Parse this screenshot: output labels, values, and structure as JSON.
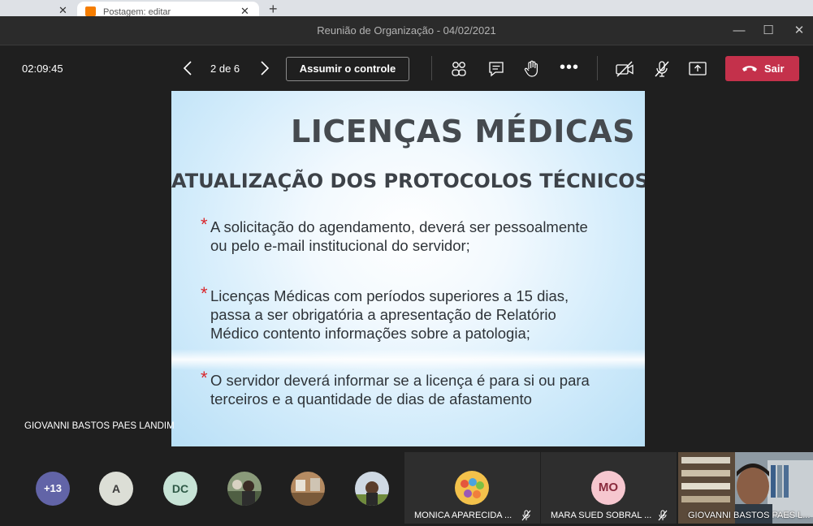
{
  "browser": {
    "tab_title": "Postagem: editar"
  },
  "window": {
    "title": "Reunião de Organização - 04/02/2021"
  },
  "toolbar": {
    "elapsed_time": "02:09:45",
    "page_indicator": "2 de 6",
    "take_control_label": "Assumir o controle",
    "leave_label": "Sair",
    "leave_color": "#c4314b"
  },
  "slide": {
    "title": "LICENÇAS MÉDICAS",
    "subtitle": "ATUALIZAÇÃO DOS PROTOCOLOS TÉCNICOS",
    "bullet_marker": "*",
    "bullets": [
      "A solicitação do agendamento, deverá ser pessoalmente\nou pelo e-mail institucional  do servidor;",
      "Licenças Médicas com períodos superiores a 15 dias,\npassa a ser obrigatória a apresentação de Relatório\nMédico contento informações sobre a patologia;",
      "O servidor deverá informar se a licença é para si ou para\nterceiros e a quantidade de dias de afastamento"
    ]
  },
  "presenter": {
    "name": "GIOVANNI BASTOS PAES LANDIM"
  },
  "participants": {
    "overflow_count": "+13",
    "avatars": [
      {
        "initials": "A",
        "bg": "#dcded6",
        "fg": "#3b3b3b"
      },
      {
        "initials": "DC",
        "bg": "#c7e3d6",
        "fg": "#2f5a47"
      }
    ],
    "tiles": [
      {
        "name": "MONICA APARECIDA ...",
        "muted": true
      },
      {
        "name": "MARA SUED SOBRAL ...",
        "initials": "MO",
        "muted": true
      }
    ],
    "video_tile_name": "GIOVANNI BASTOS PAES L..."
  }
}
